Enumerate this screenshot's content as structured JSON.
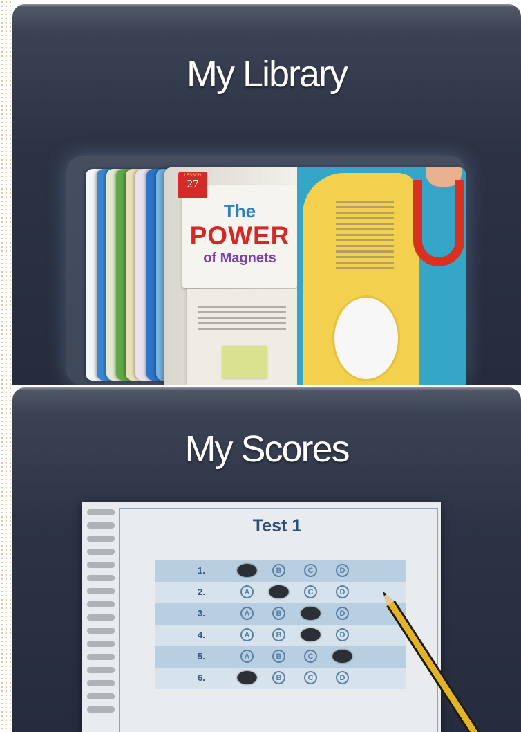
{
  "library": {
    "title": "My Library",
    "magazine": {
      "issue_label": "LESSON",
      "issue_number": "27",
      "title_line1": "The",
      "title_line2": "POWER",
      "title_line3": "of Magnets"
    }
  },
  "scores": {
    "title": "My Scores",
    "test_title": "Test 1",
    "choices": [
      "A",
      "B",
      "C",
      "D"
    ],
    "questions": [
      {
        "number": "1.",
        "filled": "A"
      },
      {
        "number": "2.",
        "filled": "B"
      },
      {
        "number": "3.",
        "filled": "C"
      },
      {
        "number": "4.",
        "filled": "C"
      },
      {
        "number": "5.",
        "filled": "D"
      },
      {
        "number": "6.",
        "filled": "A"
      }
    ]
  },
  "colors": {
    "panel": "#2c3345",
    "title_text": "#ffffff",
    "sheet_heading": "#2e4f7c"
  },
  "icons": [
    "answer-sheet-tab-icon",
    "pencil-icon",
    "magnet-icon"
  ]
}
